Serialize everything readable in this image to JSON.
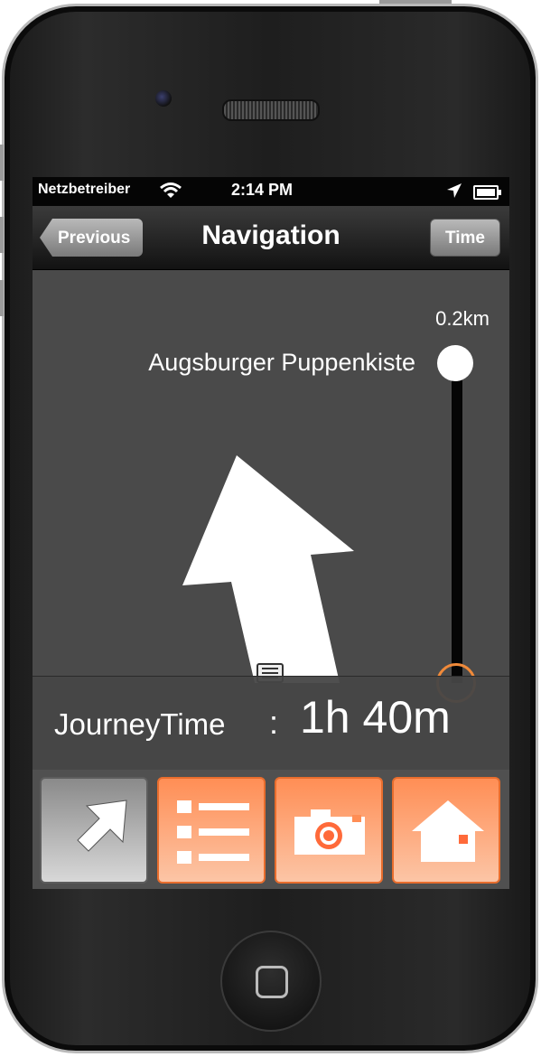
{
  "status_bar": {
    "carrier": "Netzbetreiber",
    "time": "2:14 PM",
    "wifi_icon": "wifi-icon",
    "location_icon": "location-arrow-icon",
    "battery_icon": "battery-icon"
  },
  "nav_bar": {
    "title": "Navigation",
    "back_label": "Previous",
    "right_label": "Time"
  },
  "route": {
    "distance": "0.2km",
    "destination": "Augsburger Puppenkiste",
    "direction_icon": "straight-arrow-icon"
  },
  "journey": {
    "label": "JourneyTime",
    "separator": ":",
    "value": "1h 40m"
  },
  "tabs": [
    {
      "name": "navigate",
      "icon": "diagonal-arrow-icon",
      "active": true
    },
    {
      "name": "list",
      "icon": "list-icon",
      "active": false
    },
    {
      "name": "camera",
      "icon": "camera-icon",
      "active": false
    },
    {
      "name": "home",
      "icon": "home-icon",
      "active": false
    }
  ],
  "colors": {
    "accent": "#f08a3a",
    "tab_orange": "#ff8e55",
    "background": "#4a4a4a"
  }
}
